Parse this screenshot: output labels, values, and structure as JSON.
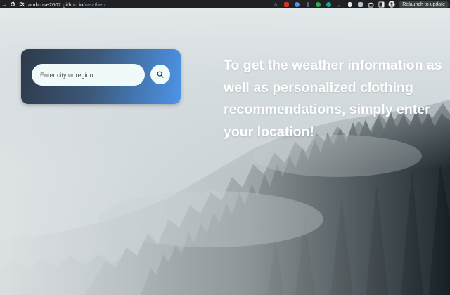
{
  "browser": {
    "url_host": "ambrose2002.github.io",
    "url_path": "/weather/",
    "relaunch_label": "Relaunch to update",
    "extensions": [
      {
        "icon": "bookmark-star-icon",
        "color": "#bdc1c6"
      },
      {
        "icon": "red-flag-extension-icon",
        "color": "#d93025"
      },
      {
        "icon": "blue-shield-extension-icon",
        "color": "#5b8def"
      },
      {
        "icon": "dark-extension-icon",
        "color": "#5f6368"
      },
      {
        "icon": "green-extension-icon",
        "color": "#34a853"
      },
      {
        "icon": "teal-extension-icon",
        "color": "#1aa39a"
      },
      {
        "icon": "tool-extension-icon",
        "color": "#e8eaed"
      },
      {
        "icon": "doc-extension-icon",
        "color": "#e8eaed"
      },
      {
        "icon": "notes-extension-icon",
        "color": "#bdc1c6"
      },
      {
        "icon": "puzzle-extensions-icon",
        "color": "#e8eaed"
      },
      {
        "icon": "side-panel-icon",
        "color": "#e8eaed"
      },
      {
        "icon": "profile-avatar-icon",
        "color": "#e8eaed"
      }
    ]
  },
  "search": {
    "placeholder": "Enter city or region",
    "value": ""
  },
  "intro_text": "To get the weather information as well as personalized clothing recommendations, simply enter your location!",
  "colors": {
    "card_gradient_start": "#2e3a4a",
    "card_gradient_end": "#4d94e8",
    "input_bg": "#f0fafb",
    "intro_text": "#ffffff"
  }
}
